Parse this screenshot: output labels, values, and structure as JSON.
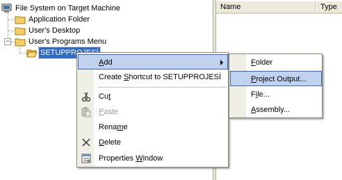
{
  "tree": {
    "root": "File System on Target Machine",
    "nodes": [
      {
        "label": "Application Folder"
      },
      {
        "label": "User's Desktop"
      },
      {
        "label": "User's Programs Menu"
      },
      {
        "label": "SETUPPROJESİ"
      }
    ]
  },
  "list": {
    "columns": [
      "Name",
      "Type"
    ]
  },
  "context_menu": {
    "items": [
      {
        "label": "Add",
        "mnemonic": "A",
        "has_submenu": true,
        "highlighted": true
      },
      {
        "label": "Create Shortcut to SETUPPROJESİ",
        "mnemonic": "S",
        "enabled": true
      },
      {
        "label": "Cut",
        "mnemonic": "t",
        "enabled": true,
        "icon": "scissors-icon"
      },
      {
        "label": "Paste",
        "mnemonic": "P",
        "enabled": false,
        "icon": "paste-icon"
      },
      {
        "label": "Rename",
        "mnemonic": "m",
        "enabled": true
      },
      {
        "label": "Delete",
        "mnemonic": "D",
        "enabled": true,
        "icon": "delete-x-icon"
      },
      {
        "label": "Properties Window",
        "mnemonic": "W",
        "enabled": true,
        "icon": "properties-icon"
      }
    ]
  },
  "submenu": {
    "items": [
      {
        "label": "Folder",
        "mnemonic": "F"
      },
      {
        "label": "Project Output...",
        "mnemonic": "P",
        "highlighted": true
      },
      {
        "label": "File...",
        "mnemonic": "i"
      },
      {
        "label": "Assembly...",
        "mnemonic": "A"
      }
    ]
  },
  "colors": {
    "selection": "#316ac5",
    "menu_highlight": "#c1d2ee",
    "folder": "#f5cf62"
  }
}
